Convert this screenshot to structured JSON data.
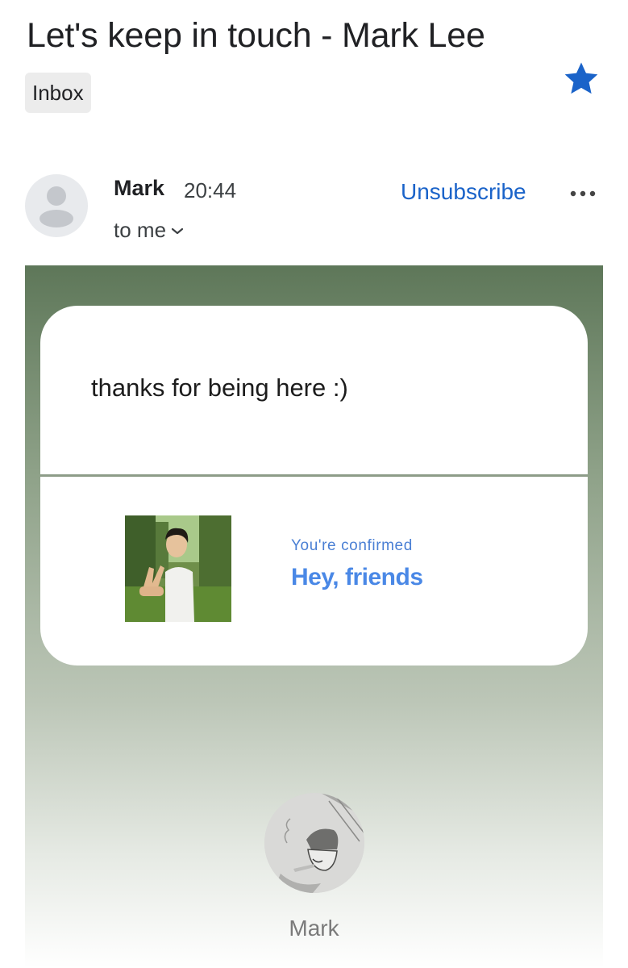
{
  "message": {
    "subject": "Let's keep in touch - Mark Lee",
    "label": "Inbox",
    "starred": true,
    "star_icon": "star-filled-icon",
    "star_color": "#1a63c9"
  },
  "sender": {
    "name": "Mark",
    "time": "20:44",
    "recipients_label": "to me",
    "unsubscribe_label": "Unsubscribe",
    "accent_color": "#1a63c9"
  },
  "body": {
    "card_message": "thanks for being here :)",
    "confirm_kicker": "You're confirmed",
    "confirm_title": "Hey, friends",
    "footer_name": "Mark",
    "gradient_top_color": "#5e7759"
  }
}
